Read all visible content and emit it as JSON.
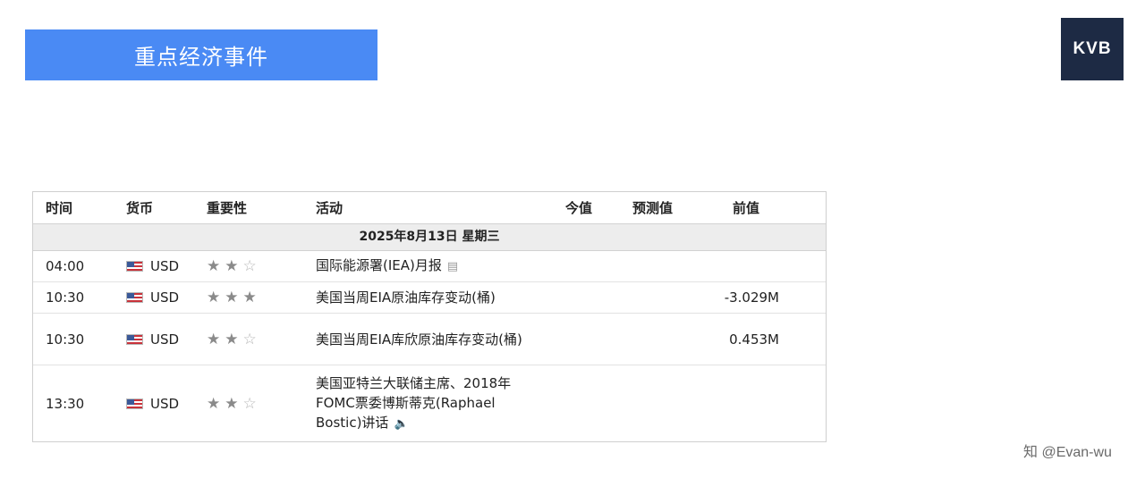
{
  "banner": {
    "title": "重点经济事件"
  },
  "logo": {
    "text": "KVB"
  },
  "calendar": {
    "headers": {
      "time": "时间",
      "currency": "货币",
      "importance": "重要性",
      "activity": "活动",
      "actual": "今值",
      "forecast": "预测值",
      "previous": "前值"
    },
    "date_label": "2025年8月13日  星期三",
    "rows": [
      {
        "time": "04:00",
        "currency": "USD",
        "stars": 2,
        "activity": "国际能源署(IEA)月报",
        "icon": "document-icon",
        "actual": "",
        "forecast": "",
        "previous": ""
      },
      {
        "time": "10:30",
        "currency": "USD",
        "stars": 3,
        "activity": "美国当周EIA原油库存变动(桶)",
        "actual": "",
        "forecast": "",
        "previous": "-3.029M"
      },
      {
        "time": "10:30",
        "currency": "USD",
        "stars": 2,
        "activity": "美国当周EIA库欣原油库存变动(桶)",
        "actual": "",
        "forecast": "",
        "previous": "0.453M"
      },
      {
        "time": "13:30",
        "currency": "USD",
        "stars": 2,
        "activity": "美国亚特兰大联储主席、2018年FOMC票委博斯蒂克(Raphael Bostic)讲话",
        "icon": "speaker-icon",
        "actual": "",
        "forecast": "",
        "previous": ""
      }
    ]
  },
  "watermark": {
    "text": "知 @Evan-wu"
  }
}
